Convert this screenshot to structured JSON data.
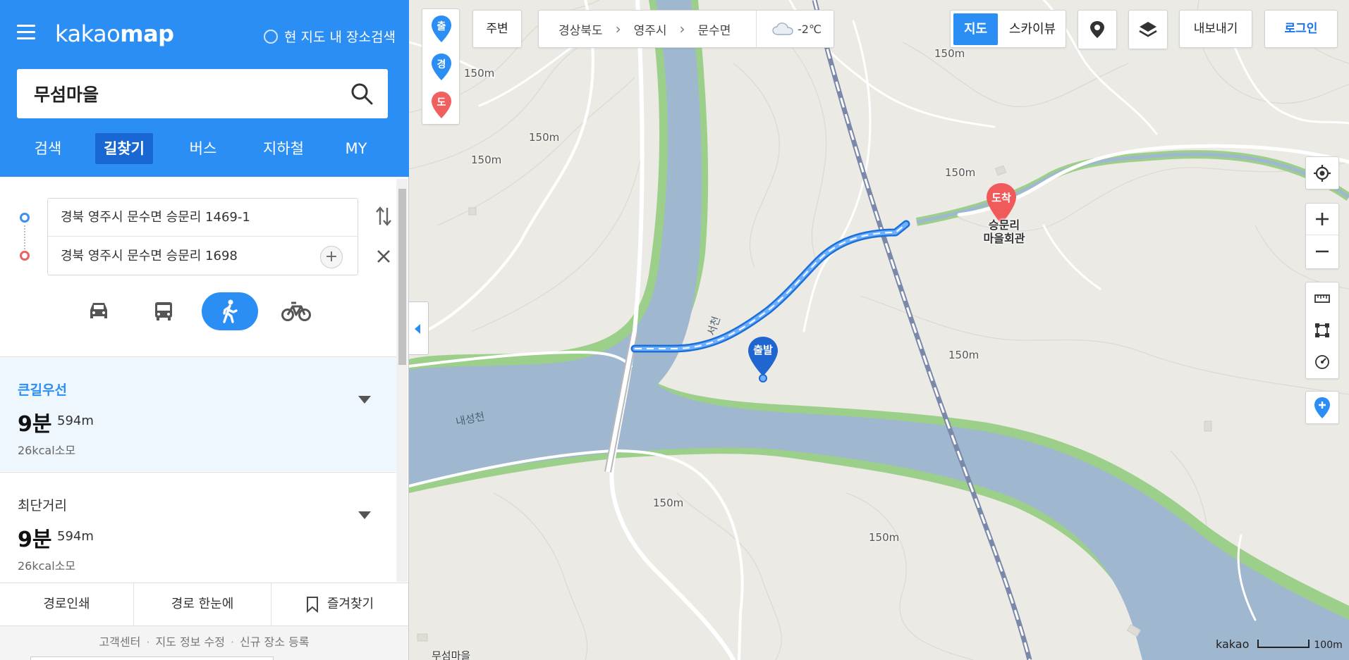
{
  "panel": {
    "logo_light": "kakao",
    "logo_bold": "map",
    "area_search_label": "현 지도 내 장소검색",
    "search_value": "무섬마을",
    "tabs": [
      {
        "label": "검색",
        "active": false
      },
      {
        "label": "길찾기",
        "active": true
      },
      {
        "label": "버스",
        "active": false
      },
      {
        "label": "지하철",
        "active": false
      },
      {
        "label": "MY",
        "active": false
      }
    ],
    "origin": "경북 영주시 문수면 승문리 1469-1",
    "destination": "경북 영주시 문수면 승문리 1698",
    "add_symbol": "+",
    "modes": [
      {
        "icon": "car-icon",
        "active": false
      },
      {
        "icon": "bus-icon",
        "active": false
      },
      {
        "icon": "walk-icon",
        "active": true
      },
      {
        "icon": "bicycle-icon",
        "active": false
      }
    ],
    "results": [
      {
        "name": "큰길우선",
        "time": "9분",
        "distance": "594m",
        "calories": "26kcal소모",
        "selected": true
      },
      {
        "name": "최단거리",
        "time": "9분",
        "distance": "594m",
        "calories": "26kcal소모",
        "selected": false
      }
    ],
    "footer_buttons": [
      "경로인쇄",
      "경로 한눈에",
      "즐겨찾기"
    ],
    "footer_links": [
      "고객센터",
      "지도 정보 수정",
      "신규 장소 등록"
    ]
  },
  "map": {
    "pins": [
      {
        "label": "출",
        "color": "#2a8ef5"
      },
      {
        "label": "경",
        "color": "#2a8ef5"
      },
      {
        "label": "도",
        "color": "#f06060"
      }
    ],
    "around_label": "주변",
    "breadcrumbs": [
      "경상북도",
      "영주시",
      "문수면"
    ],
    "weather": {
      "icon": "cloud-icon",
      "temp": "-2℃"
    },
    "map_types": [
      {
        "label": "지도",
        "active": true
      },
      {
        "label": "스카이뷰",
        "active": false
      }
    ],
    "export_label": "내보내기",
    "login_label": "로그인",
    "start_marker": "출발",
    "end_marker": "도착",
    "place_label_lines": [
      "승문리",
      "마을회관"
    ],
    "contour_labels": [
      "150m",
      "150m",
      "150m",
      "150m",
      "150m",
      "150m",
      "150m",
      "150m"
    ],
    "river_labels": [
      "서천",
      "내성천"
    ],
    "bottom_place": "무섬마을",
    "scale_brand": "kakao",
    "scale_value": "100m",
    "colors": {
      "accent": "#2a8ef5",
      "route": "#3b8df0",
      "river": "#9fb7cf",
      "riverbank": "#9cd08a",
      "land": "#eceae4",
      "rail": "#7a88aa"
    }
  }
}
